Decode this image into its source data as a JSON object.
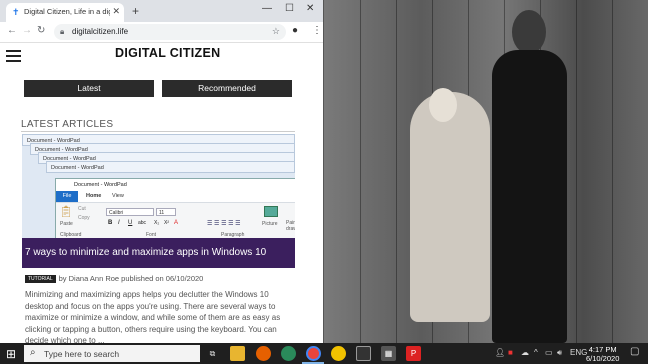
{
  "browser": {
    "tab_title": "Digital Citizen, Life in a digital w",
    "url": "digitalcitizen.life"
  },
  "site": {
    "logo": "DIGITAL CITIZEN",
    "nav": [
      "Latest",
      "Recommended"
    ],
    "section_title": "LATEST ARTICLES"
  },
  "thumbnail": {
    "window_title": "Document - WordPad",
    "ribbon_tabs": [
      "File",
      "Home",
      "View"
    ],
    "font_name": "Calibri",
    "font_size": "11",
    "groups": [
      "Clipboard",
      "Font",
      "Paragraph"
    ],
    "paste_label": "Paste",
    "cut_label": "Cut",
    "copy_label": "Copy",
    "picture_label": "Picture",
    "paint_label": "Pain draw"
  },
  "article": {
    "title": "7 ways to minimize and maximize apps in Windows 10",
    "tag": "TUTORIAL",
    "meta": "by Diana Ann Roe published on 06/10/2020",
    "excerpt": "Minimizing and maximizing apps helps you declutter the Windows 10 desktop and focus on the apps you're using. There are several ways to maximize or minimize a window, and while some of them are as easy as clicking or tapping a button, others require using the keyboard. You can decide which one to ..."
  },
  "taskbar": {
    "search_placeholder": "Type here to search",
    "language": "ENG",
    "time": "4:17 PM",
    "date": "6/10/2020"
  },
  "colors": {
    "banner": "#3b1f5e",
    "nav_button": "#2b2b2b",
    "taskbar": "#1f1f1f"
  }
}
